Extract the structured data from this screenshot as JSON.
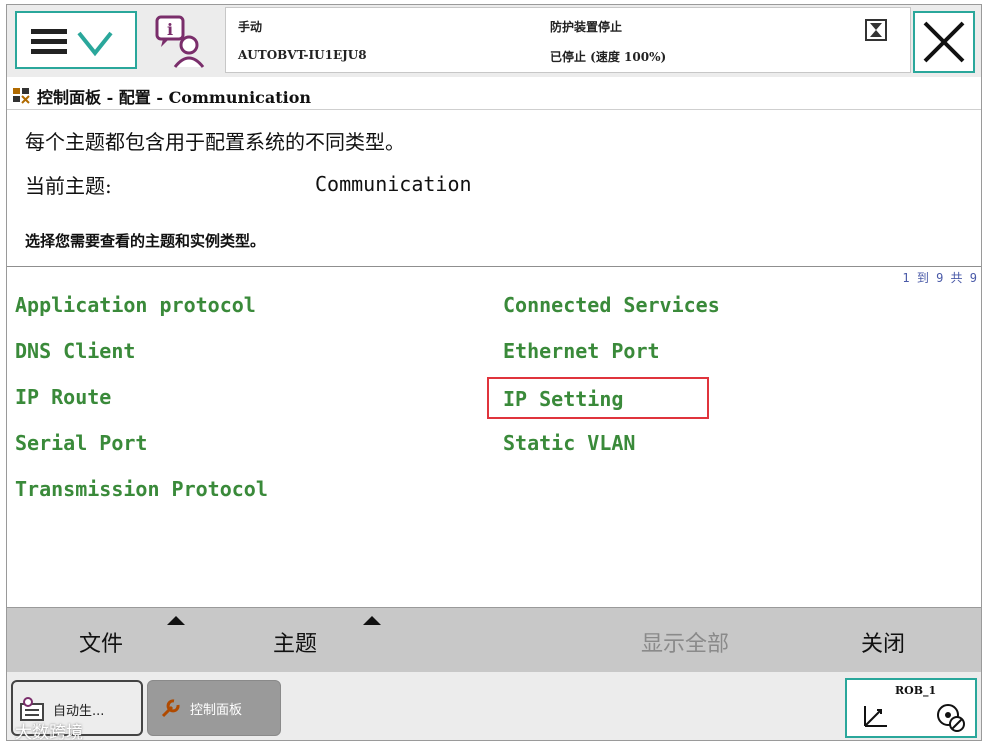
{
  "header": {
    "mode": "手动",
    "system_name": "AUTOBVT-IU1EJU8",
    "status_line1": "防护装置停止",
    "status_line2": "已停止 (速度 100%)"
  },
  "breadcrumb": {
    "path": "控制面板 - 配置 - Communication"
  },
  "intro": {
    "description": "每个主题都包含用于配置系统的不同类型。",
    "current_topic_label": "当前主题:",
    "current_topic_value": "Communication",
    "instruction": "选择您需要查看的主题和实例类型。"
  },
  "list": {
    "page_count": "1 到 9 共 9",
    "left_column": [
      "Application protocol",
      "DNS Client",
      "IP Route",
      "Serial Port",
      "Transmission Protocol"
    ],
    "right_column": [
      "Connected Services",
      "Ethernet Port",
      "IP Setting",
      "Static VLAN"
    ],
    "selected": "IP Setting"
  },
  "commands": {
    "file": "文件",
    "topic": "主题",
    "show_all": "显示全部",
    "close": "关闭"
  },
  "taskbar": {
    "auto_task": "自动生...",
    "control_panel_task": "控制面板",
    "robot": "ROB_1",
    "watermark": "大数跨境"
  },
  "colors": {
    "accent": "#2aa79b",
    "topic_text": "#3a8a3a",
    "selection": "#e0343c"
  }
}
